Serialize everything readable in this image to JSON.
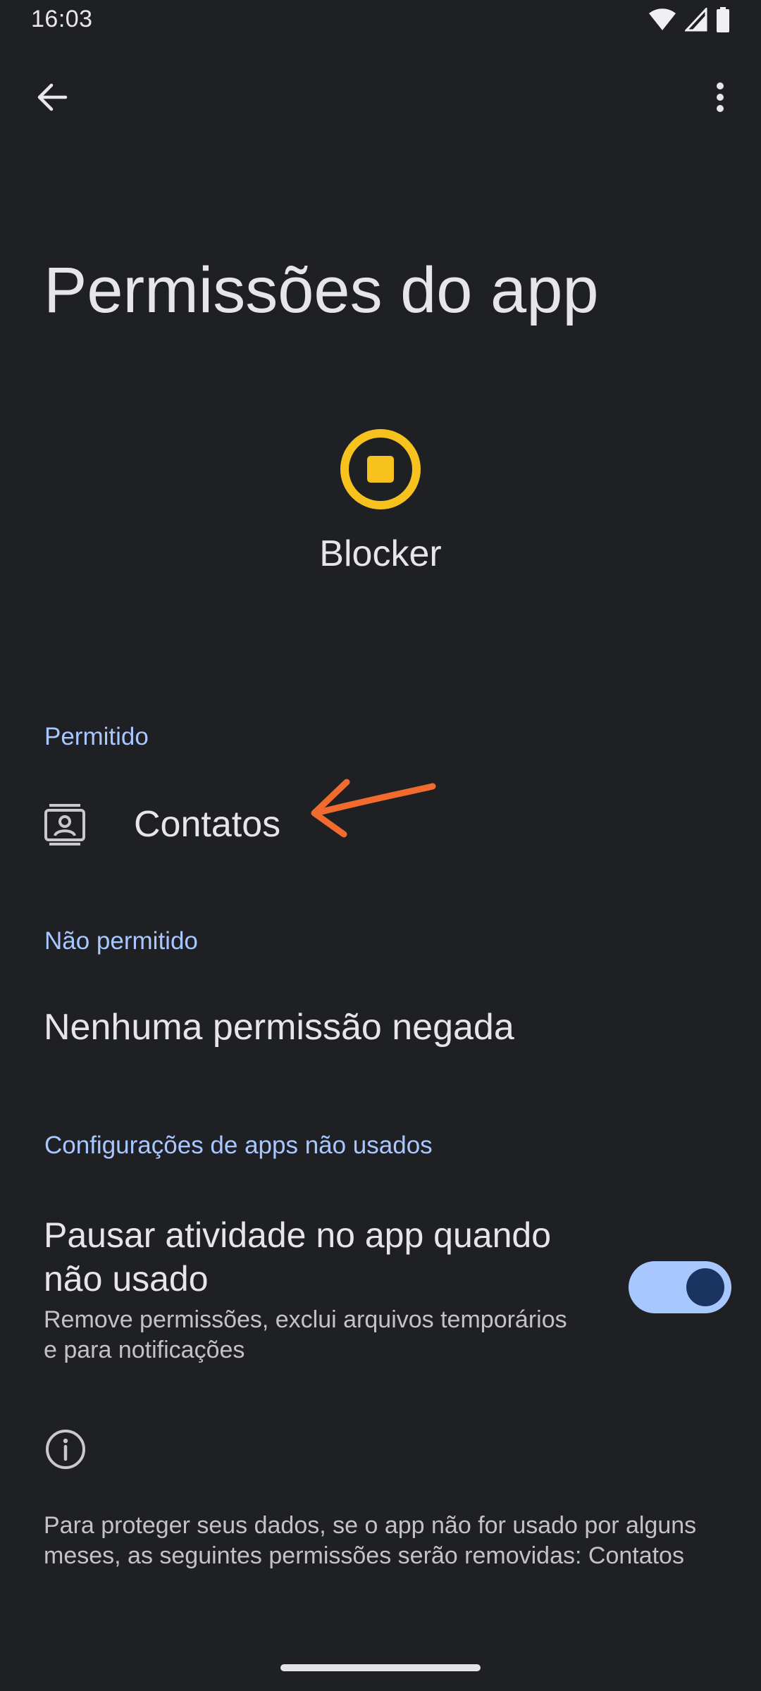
{
  "status_bar": {
    "time": "16:03"
  },
  "header": {
    "title": "Permissões do app"
  },
  "app": {
    "name": "Blocker",
    "icon_color": "#f7c21e"
  },
  "sections": {
    "allowed": {
      "header": "Permitido",
      "items": [
        {
          "label": "Contatos",
          "icon": "contacts-icon"
        }
      ]
    },
    "not_allowed": {
      "header": "Não permitido",
      "empty_text": "Nenhuma permissão negada"
    },
    "unused_apps": {
      "header": "Configurações de apps não usados",
      "pause_title": "Pausar atividade no app quando não usado",
      "pause_subtitle": "Remove permissões, exclui arquivos temporários e para notificações",
      "toggle_on": true
    }
  },
  "info": {
    "text": "Para proteger seus dados, se o app não for usado por alguns meses, as seguintes permissões serão removidas: Contatos"
  },
  "colors": {
    "background": "#1f2024",
    "accent": "#a9c7ff",
    "annotation": "#f26b2e"
  }
}
